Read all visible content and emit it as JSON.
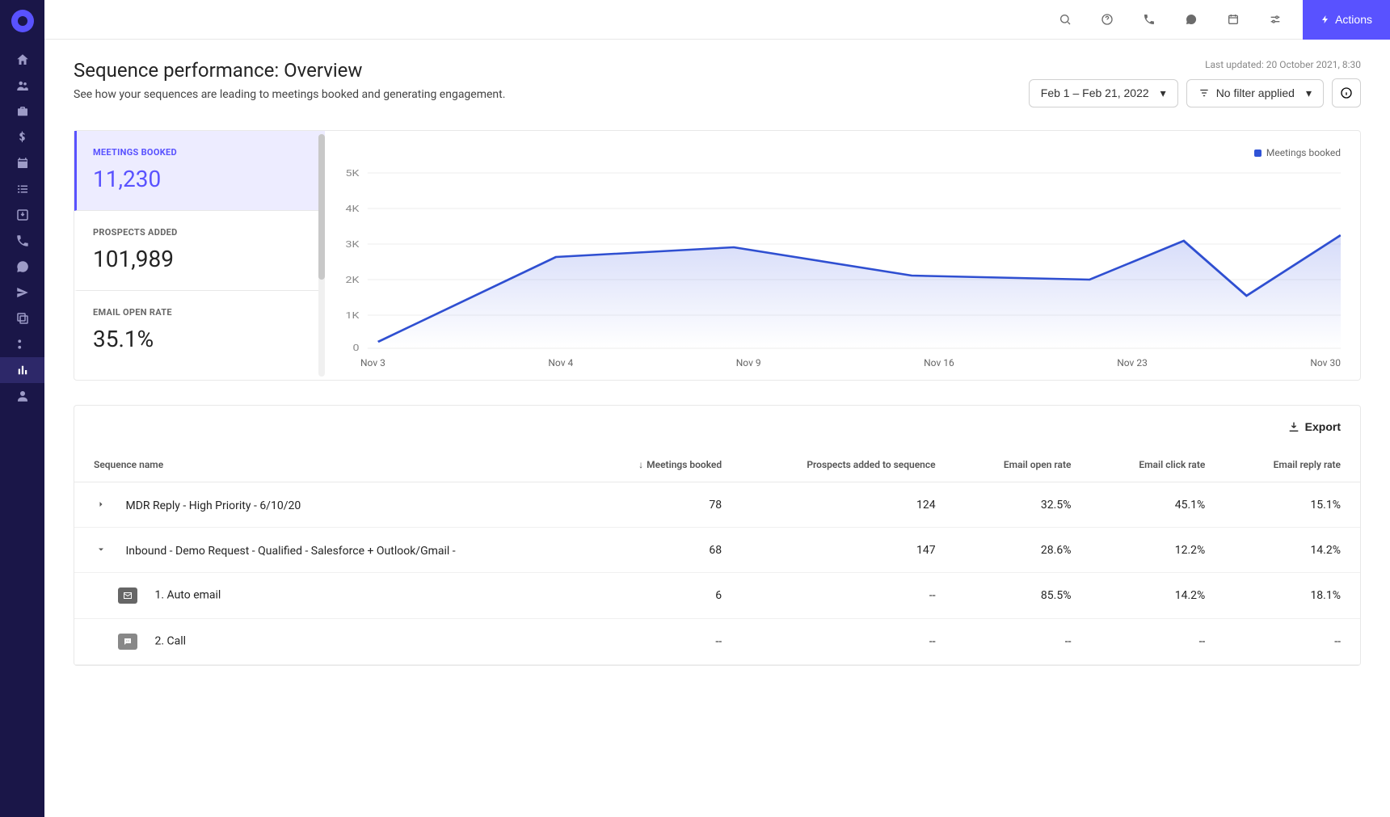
{
  "topbar": {
    "actions_label": "Actions"
  },
  "header": {
    "title": "Sequence performance: Overview",
    "subtitle": "See how your sequences are leading to meetings booked and generating engagement.",
    "last_updated": "Last updated: 20 October 2021, 8:30",
    "date_range": "Feb 1 – Feb 21, 2022",
    "filter_label": "No filter applied"
  },
  "kpis": [
    {
      "label": "MEETINGS BOOKED",
      "value": "11,230",
      "active": true
    },
    {
      "label": "PROSPECTS ADDED",
      "value": "101,989",
      "active": false
    },
    {
      "label": "EMAIL OPEN RATE",
      "value": "35.1%",
      "active": false
    }
  ],
  "legend": {
    "series": "Meetings booked"
  },
  "chart_data": {
    "type": "area",
    "title": "",
    "xlabel": "",
    "ylabel": "",
    "ylim": [
      0,
      5000
    ],
    "y_ticks": [
      "5K",
      "4K",
      "3K",
      "2K",
      "1K",
      "0"
    ],
    "categories": [
      "Nov 3",
      "Nov 4",
      "Nov 9",
      "Nov 16",
      "Nov 23",
      "Nov 30"
    ],
    "series": [
      {
        "name": "Meetings booked",
        "values": [
          200,
          2600,
          2900,
          2050,
          3100,
          1550,
          3200
        ]
      }
    ],
    "note": "7 visible data points across 6 x-axis labels; last point overlaps right edge"
  },
  "table": {
    "export_label": "Export",
    "columns": [
      "Sequence name",
      "Meetings booked",
      "Prospects added to sequence",
      "Email open rate",
      "Email click rate",
      "Email reply rate"
    ],
    "sort_column_index": 1,
    "rows": [
      {
        "expand": "closed",
        "name": "MDR Reply - High Priority - 6/10/20",
        "meetings": "78",
        "prospects": "124",
        "open": "32.5%",
        "click": "45.1%",
        "reply": "15.1%"
      },
      {
        "expand": "open",
        "name": "Inbound - Demo Request - Qualified - Salesforce + Outlook/Gmail -",
        "meetings": "68",
        "prospects": "147",
        "open": "28.6%",
        "click": "12.2%",
        "reply": "14.2%",
        "steps": [
          {
            "icon": "email",
            "label": "1.  Auto email",
            "meetings": "6",
            "prospects": "--",
            "open": "85.5%",
            "click": "14.2%",
            "reply": "18.1%"
          },
          {
            "icon": "chat",
            "label": "2. Call",
            "meetings": "--",
            "prospects": "--",
            "open": "--",
            "click": "--",
            "reply": "--"
          }
        ]
      }
    ]
  }
}
